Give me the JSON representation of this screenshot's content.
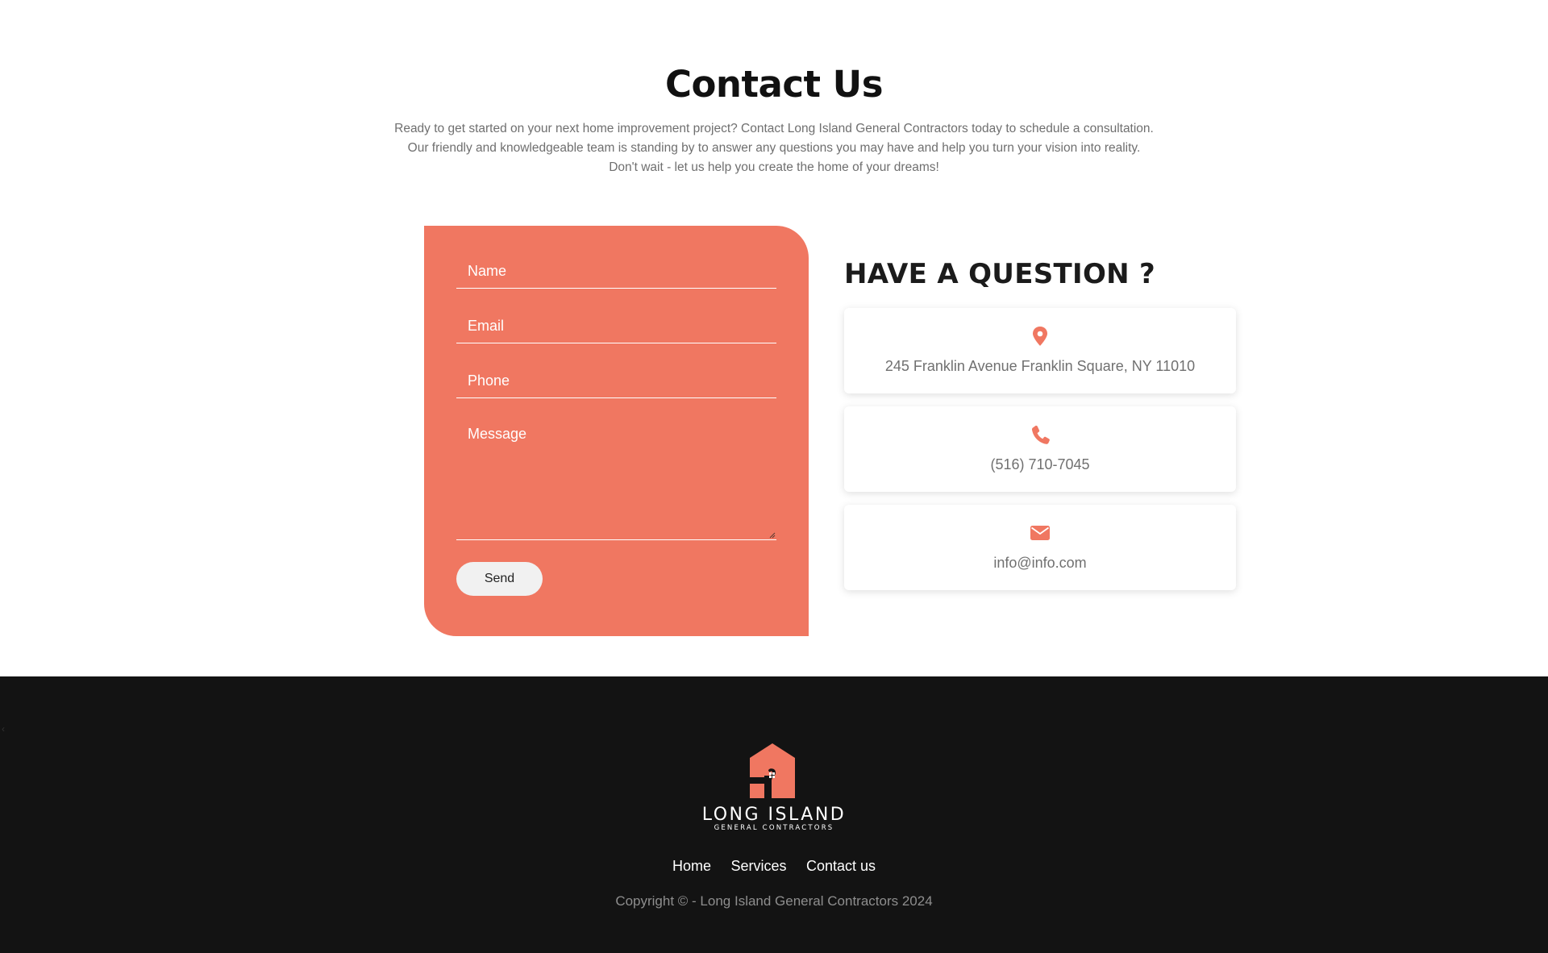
{
  "contact": {
    "title": "Contact Us",
    "intro_lines": [
      "Ready to get started on your next home improvement project? Contact Long Island General Contractors today to schedule a consultation.",
      "Our friendly and knowledgeable team is standing by to answer any questions you may have and help you turn your vision into reality.",
      "Don't wait - let us help you create the home of your dreams!"
    ]
  },
  "form": {
    "name_placeholder": "Name",
    "email_placeholder": "Email",
    "phone_placeholder": "Phone",
    "message_placeholder": "Message",
    "send_label": "Send",
    "background_color": "#f07761"
  },
  "info": {
    "title": "HAVE A QUESTION ?",
    "address": "245 Franklin Avenue Franklin Square, NY 11010",
    "phone": "(516) 710-7045",
    "email": "info@info.com",
    "icons": [
      "map-pin-icon",
      "phone-icon",
      "envelope-icon"
    ],
    "accent_color": "#f07761"
  },
  "footer": {
    "logo_name": "LONG ISLAND",
    "logo_sub": "GENERAL CONTRACTORS",
    "nav": [
      "Home",
      "Services",
      "Contact us"
    ],
    "copyright": "Copyright © - Long Island General Contractors 2024",
    "background_color": "#131313"
  }
}
